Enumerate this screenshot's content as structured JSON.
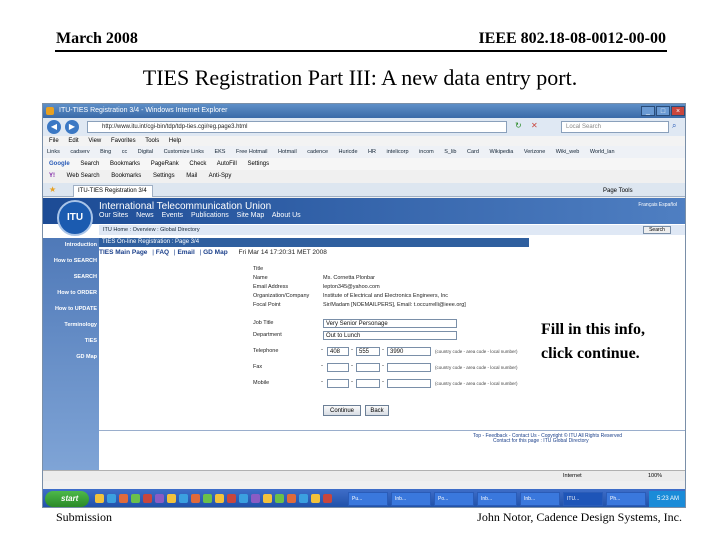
{
  "slide": {
    "header_left": "March 2008",
    "header_right": "IEEE 802.18-08-0012-00-00",
    "title": "TIES Registration Part III: A new data entry port.",
    "callout": [
      "Fill in this info,",
      "click continue."
    ],
    "footer_left": "Submission",
    "footer_right": "John Notor, Cadence Design Systems, Inc."
  },
  "browser": {
    "window_title": "ITU-TIES Registration 3/4 - Windows Internet Explorer",
    "url": "http://www.itu.int/cgi-bin/tdp/tdp-ties.cgi/reg.page3.html",
    "search_placeholder": "Local Search",
    "menu": [
      "File",
      "Edit",
      "View",
      "Favorites",
      "Tools",
      "Help"
    ],
    "links": [
      "Links",
      "cadserv",
      "Bing",
      "cc",
      "Digital",
      "Customize Links",
      "EKS",
      "Free Hotmail",
      "Hotmail",
      "cadence",
      "Huricde",
      "HR",
      "intelicorp",
      "incom",
      "S_lib",
      "Card",
      "Wikipedia",
      "Verizone",
      "Wiki_web",
      "World_lan"
    ],
    "google_label": "Google",
    "google_items": [
      "Search",
      "Bookmarks",
      "PageRank",
      "Check",
      "AutoFill",
      "Settings"
    ],
    "yahoo_items": [
      "Web Search",
      "Bookmarks",
      "Settings",
      "Mail",
      "Anti-Spy"
    ],
    "tab_label": "ITU-TIES Registration 3/4",
    "tab_tools": "Page   Tools",
    "status_zone": "Internet",
    "zoom": "100%"
  },
  "itu": {
    "logo_text": "ITU",
    "org_name": "International Telecommunication Union",
    "nav": [
      "Our Sites",
      "News",
      "Events",
      "Publications",
      "Site Map",
      "About Us"
    ],
    "lang": "Français Español",
    "breadcrumb": "ITU Home : Overview : Global Directory",
    "search_button": "Search",
    "left_nav": [
      "Introduction",
      "How to SEARCH",
      "SEARCH",
      "How to ORDER",
      "How to UPDATE",
      "Terminology",
      "TIES",
      "GD Map"
    ],
    "banner": "TIES On-line Registration : Page 3/4",
    "link_row": [
      "TIES Main Page",
      "FAQ",
      "Email",
      "GD Map"
    ],
    "link_sep": "|",
    "date": "Fri Mar 14 17:20:31 MET 2008"
  },
  "form": {
    "static_rows": [
      {
        "label": "Title",
        "value": ""
      },
      {
        "label": "Name",
        "value": "Ms. Cornetta Plonbar"
      },
      {
        "label": "Email Address",
        "value": "lepton345@yahoo.com"
      },
      {
        "label": "Organization/Company",
        "value": "Institute of Electrical and Electronics Engineers, Inc"
      },
      {
        "label": "Focal Point",
        "value": "Sir/Madam [NOEMAILPERS], Email: t.occurrelli@ieee.org]"
      }
    ],
    "job_title_label": "Job Title",
    "job_title_value": "Very Senior Personage",
    "department_label": "Department",
    "department_value": "Out to Lunch",
    "telephone_label": "Telephone",
    "telephone_parts": [
      "408",
      "555",
      "3990"
    ],
    "phone_hint": "(country code - area code - local number)",
    "fax_label": "Fax",
    "mobile_label": "Mobile",
    "dash": "-",
    "continue_label": "Continue",
    "back_label": "Back",
    "footer_links": "Top - Feedback - Contact Us - Copyright © ITU All Rights Reserved",
    "footer_contact": "Contact for this page : ITU Global Directory"
  },
  "taskbar": {
    "start_label": "start",
    "tasks": [
      "Pu...",
      "Inb...",
      "Po...",
      "Inb...",
      "Inb...",
      "ITU...",
      "Ph..."
    ],
    "clock": "5:23 AM"
  }
}
